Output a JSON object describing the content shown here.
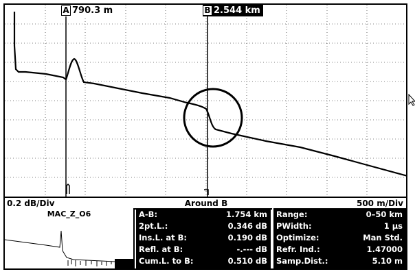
{
  "cursors": {
    "a": {
      "letter": "A",
      "distance": "790.3 m"
    },
    "b": {
      "letter": "B",
      "distance": "2.544 km"
    }
  },
  "scale": {
    "vertical": "0.2 dB/Div",
    "center": "Around B",
    "horizontal": "500 m/Div"
  },
  "overview": {
    "trace_name": "MAC_Z_O6"
  },
  "results": [
    {
      "label": "A-B:",
      "value": "1.754 km"
    },
    {
      "label": "2pt.L.:",
      "value": "0.346 dB"
    },
    {
      "label": "Ins.L. at B:",
      "value": "0.190 dB"
    },
    {
      "label": "Refl. at B:",
      "value": "-.--- dB"
    },
    {
      "label": "Cum.L. to B:",
      "value": "0.510 dB"
    }
  ],
  "settings": [
    {
      "label": "Range:",
      "value": "0–50 km"
    },
    {
      "label": "PWidth:",
      "value": "1 µs"
    },
    {
      "label": "Optimize:",
      "value": "Man Std."
    },
    {
      "label": "Refr. Ind.:",
      "value": "1.47000"
    },
    {
      "label": "Samp.Dist.:",
      "value": "5.10 m"
    }
  ],
  "colors": {
    "trace": "#000000",
    "grid": "#000000",
    "panel_bg": "#000000",
    "panel_text": "#ffffff"
  }
}
